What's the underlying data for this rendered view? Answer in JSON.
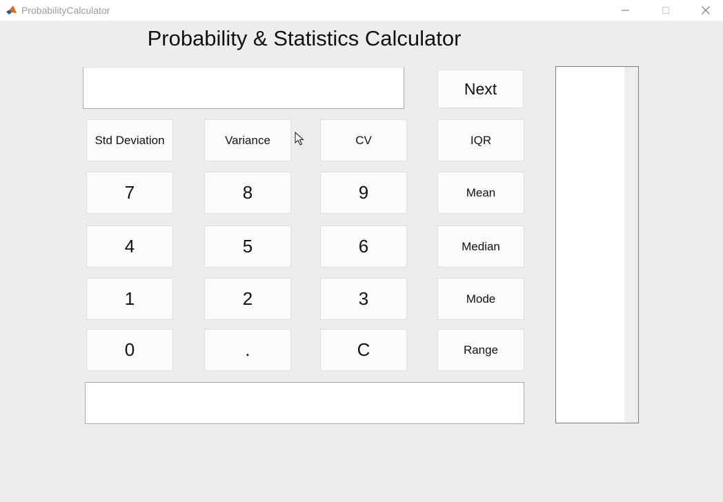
{
  "window": {
    "title": "ProbabilityCalculator",
    "app_icon": "matlab-logo-icon",
    "controls": [
      "minimize-icon",
      "maximize-icon",
      "close-icon"
    ]
  },
  "app": {
    "title": "Probability & Statistics Calculator"
  },
  "input_field": {
    "value": ""
  },
  "output_field": {
    "value": ""
  },
  "listbox": {
    "items": []
  },
  "buttons": {
    "next": "Next",
    "std_deviation": "Std Deviation",
    "variance": "Variance",
    "cv": "CV",
    "iqr": "IQR",
    "mean": "Mean",
    "median": "Median",
    "mode": "Mode",
    "range": "Range",
    "digit_7": "7",
    "digit_8": "8",
    "digit_9": "9",
    "digit_4": "4",
    "digit_5": "5",
    "digit_6": "6",
    "digit_1": "1",
    "digit_2": "2",
    "digit_3": "3",
    "digit_0": "0",
    "decimal": ".",
    "clear": "C"
  },
  "colors": {
    "window_bg": "#f0f0f0",
    "button_bg": "#fbfbfb",
    "field_bg": "#ffffff",
    "text": "#111111"
  }
}
